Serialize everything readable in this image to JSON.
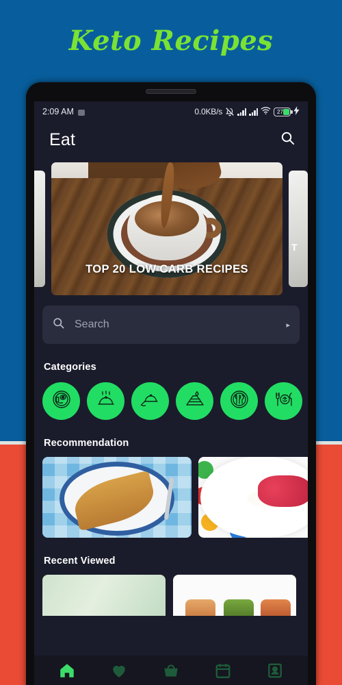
{
  "promo": {
    "title": "Keto Recipes",
    "title_color": "#7ae234",
    "bg_top_color": "#085e9c",
    "bg_bottom_color": "#e94b35"
  },
  "statusbar": {
    "time": "2:09 AM",
    "network_speed": "0.0KB/s",
    "battery_level": "27",
    "icons": [
      "ghost-icon",
      "bell-mute-icon",
      "signal-bars-icon",
      "signal-bars-icon",
      "wifi-icon",
      "battery-icon",
      "charging-bolt-icon"
    ]
  },
  "appbar": {
    "title": "Eat",
    "search_icon": "search-icon"
  },
  "carousel": {
    "main_caption": "TOP 20 LOW CARB RECIPES",
    "right_peek_caption": "T"
  },
  "search": {
    "placeholder": "Search",
    "icon": "search-icon",
    "chevron": "▸"
  },
  "categories": {
    "title": "Categories",
    "accent_color": "#22dd63",
    "items": [
      {
        "name": "breakfast-plate-icon"
      },
      {
        "name": "steaming-cloche-icon"
      },
      {
        "name": "served-cloche-icon"
      },
      {
        "name": "cake-slice-icon"
      },
      {
        "name": "plate-cutlery-icon"
      },
      {
        "name": "fork-plate-knife-icon"
      }
    ]
  },
  "recommendation": {
    "title": "Recommendation",
    "items": [
      {
        "name": "omelette-card"
      },
      {
        "name": "berry-dessert-card"
      }
    ]
  },
  "recent_viewed": {
    "title": "Recent Viewed",
    "items": [
      {
        "name": "green-gradient-card"
      },
      {
        "name": "appetizers-card"
      }
    ]
  },
  "bottomnav": {
    "active_color": "#3ddc6a",
    "inactive_color": "#1e5b3a",
    "items": [
      {
        "name": "nav-home",
        "icon": "home-icon",
        "active": true
      },
      {
        "name": "nav-favorites",
        "icon": "heart-icon",
        "active": false
      },
      {
        "name": "nav-basket",
        "icon": "basket-icon",
        "active": false
      },
      {
        "name": "nav-calendar",
        "icon": "calendar-icon",
        "active": false
      },
      {
        "name": "nav-profile",
        "icon": "person-icon",
        "active": false
      }
    ]
  }
}
